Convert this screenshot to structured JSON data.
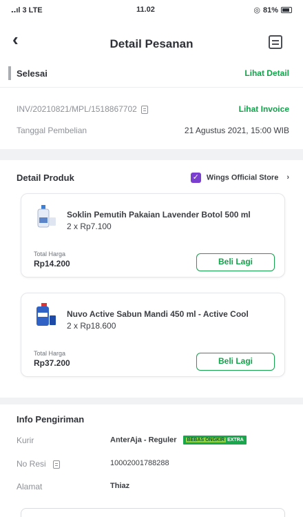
{
  "status_bar": {
    "signal": "‥ıl 3 LTE",
    "time": "11.02",
    "battery": "81%"
  },
  "header": {
    "title": "Detail Pesanan",
    "back_icon": "chevron-left-icon",
    "menu_icon": "document-icon"
  },
  "order_status": {
    "status": "Selesai",
    "detail_link": "Lihat Detail"
  },
  "invoice": {
    "number": "INV/20210821/MPL/1518867702",
    "invoice_link": "Lihat Invoice",
    "date_label": "Tanggal Pembelian",
    "date_value": "21 Agustus 2021, 15:00 WIB"
  },
  "products": {
    "section_title": "Detail Produk",
    "store_name": "Wings Official Store",
    "items": [
      {
        "name": "Soklin Pemutih Pakaian Lavender Botol 500 ml",
        "qty_price": "2 x Rp7.100",
        "total_label": "Total Harga",
        "total_value": "Rp14.200",
        "button": "Beli Lagi"
      },
      {
        "name": "Nuvo Active Sabun Mandi 450 ml - Active Cool",
        "qty_price": "2 x Rp18.600",
        "total_label": "Total Harga",
        "total_value": "Rp37.200",
        "button": "Beli Lagi"
      }
    ]
  },
  "shipping": {
    "section_title": "Info Pengiriman",
    "courier_label": "Kurir",
    "courier_value": "AnterAja - Reguler",
    "courier_badge_a": "BEBAS ONGKIR",
    "courier_badge_b": "EXTRA",
    "receipt_label": "No Resi",
    "receipt_value": "10002001788288",
    "address_label": "Alamat",
    "address_value": "Thiaz"
  },
  "colors": {
    "accent_green": "#12a34a",
    "store_purple": "#7b3fd0"
  }
}
